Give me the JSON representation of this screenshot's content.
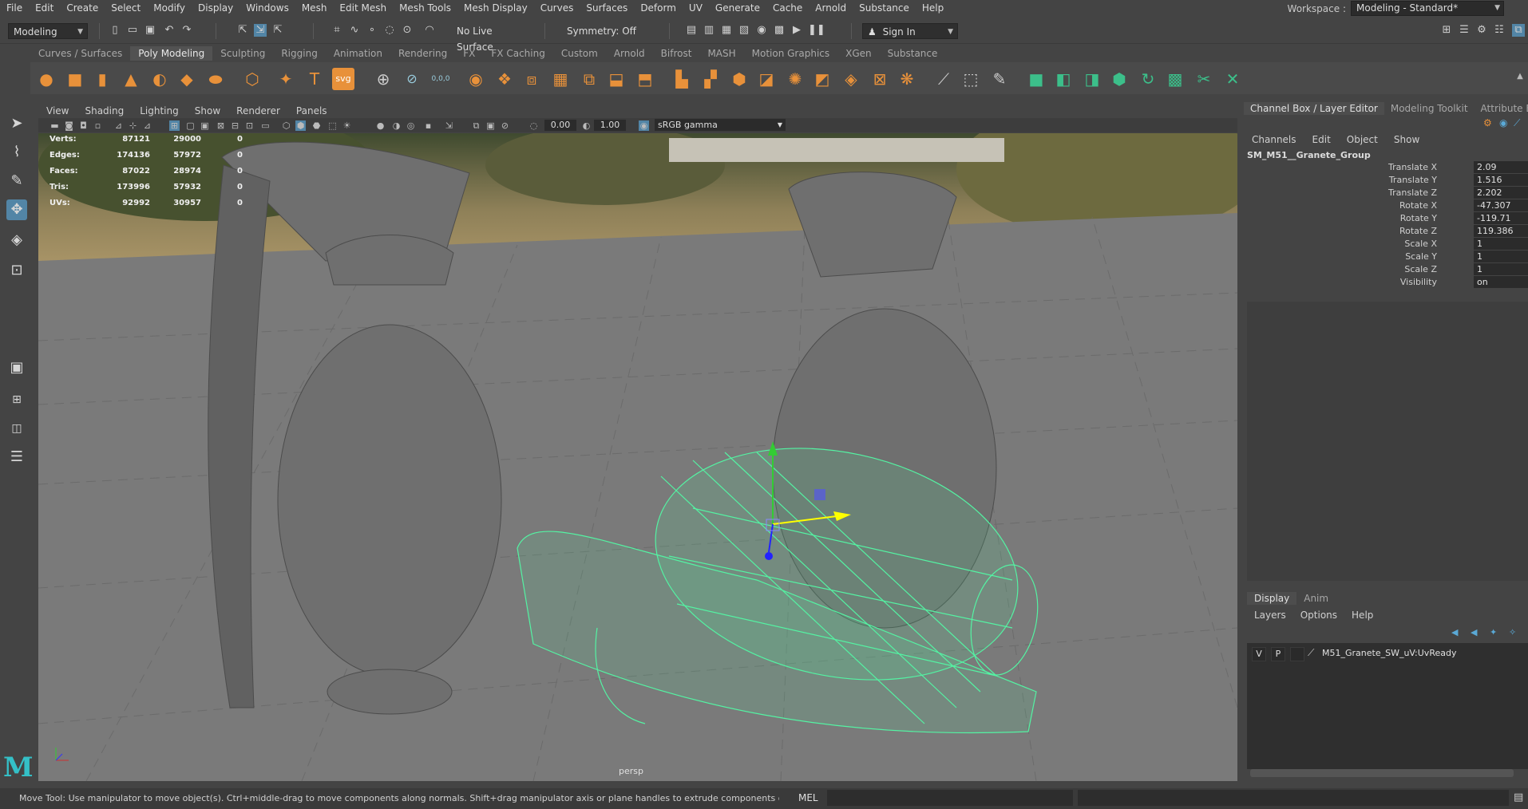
{
  "menubar": {
    "items": [
      "File",
      "Edit",
      "Create",
      "Select",
      "Modify",
      "Display",
      "Windows",
      "Mesh",
      "Edit Mesh",
      "Mesh Tools",
      "Mesh Display",
      "Curves",
      "Surfaces",
      "Deform",
      "UV",
      "Generate",
      "Cache",
      "Arnold",
      "Substance",
      "Help"
    ],
    "workspace_label": "Workspace :",
    "workspace_value": "Modeling - Standard*"
  },
  "statusline": {
    "menuset": "Modeling",
    "live_surface": "No Live Surface",
    "symmetry": "Symmetry: Off",
    "sign_in": "Sign In"
  },
  "shelf": {
    "tabs": [
      "Curves / Surfaces",
      "Poly Modeling",
      "Sculpting",
      "Rigging",
      "Animation",
      "Rendering",
      "FX",
      "FX Caching",
      "Custom",
      "Arnold",
      "Bifrost",
      "MASH",
      "Motion Graphics",
      "XGen",
      "Substance"
    ],
    "active_tab": "Poly Modeling",
    "text_icons": {
      "type": "T",
      "svg": "svg",
      "zero": "0,0,0"
    }
  },
  "viewport": {
    "panel_menu": [
      "View",
      "Shading",
      "Lighting",
      "Show",
      "Renderer",
      "Panels"
    ],
    "exposure": "0.00",
    "gamma": "1.00",
    "color_space": "sRGB gamma",
    "camera": "persp",
    "hud": [
      {
        "label": "Verts:",
        "total": "87121",
        "selected": "29000",
        "comp": "0"
      },
      {
        "label": "Edges:",
        "total": "174136",
        "selected": "57972",
        "comp": "0"
      },
      {
        "label": "Faces:",
        "total": "87022",
        "selected": "28974",
        "comp": "0"
      },
      {
        "label": "Tris:",
        "total": "173996",
        "selected": "57932",
        "comp": "0"
      },
      {
        "label": "UVs:",
        "total": "92992",
        "selected": "30957",
        "comp": "0"
      }
    ]
  },
  "channelbox": {
    "tabs": [
      "Channel Box / Layer Editor",
      "Modeling Toolkit",
      "Attribute E"
    ],
    "menu": [
      "Channels",
      "Edit",
      "Object",
      "Show"
    ],
    "object_name": "SM_M51__Granete_Group",
    "attributes": [
      {
        "name": "Translate X",
        "value": "2.09"
      },
      {
        "name": "Translate Y",
        "value": "1.516"
      },
      {
        "name": "Translate Z",
        "value": "2.202"
      },
      {
        "name": "Rotate X",
        "value": "-47.307"
      },
      {
        "name": "Rotate Y",
        "value": "-119.71"
      },
      {
        "name": "Rotate Z",
        "value": "119.386"
      },
      {
        "name": "Scale X",
        "value": "1"
      },
      {
        "name": "Scale Y",
        "value": "1"
      },
      {
        "name": "Scale Z",
        "value": "1"
      },
      {
        "name": "Visibility",
        "value": "on"
      }
    ]
  },
  "layers": {
    "tabs": [
      "Display",
      "Anim"
    ],
    "menu": [
      "Layers",
      "Options",
      "Help"
    ],
    "rows": [
      {
        "v": "V",
        "p": "P",
        "name": "M51_Granete_SW_uV:UvReady"
      }
    ]
  },
  "helpline": {
    "text": "Move Tool: Use manipulator to move object(s). Ctrl+middle-drag to move components along normals. Shift+drag manipulator axis or plane handles to extrude components or clone objects. Ctrl+Shift+drag to constra",
    "mel": "MEL"
  },
  "colors": {
    "wireframe": "#54f3a3",
    "accent": "#5285a6",
    "shelf_orange": "#e8913a",
    "logo": "#34c0c7"
  },
  "icons": {
    "logo": "M"
  }
}
